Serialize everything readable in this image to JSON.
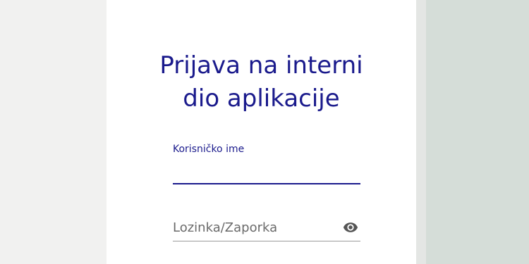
{
  "login": {
    "title_line1": "Prijava na interni",
    "title_line2": "dio aplikacije",
    "username_label": "Korisničko ime",
    "username_value": "",
    "password_placeholder": "Lozinka/Zaporka",
    "password_value": ""
  },
  "icons": {
    "password_toggle": "eye-icon"
  },
  "colors": {
    "accent": "#1a1a8c",
    "card_background": "#ffffff",
    "page_background": "#f1f1f0",
    "side_panel": "#d5ddd8"
  }
}
